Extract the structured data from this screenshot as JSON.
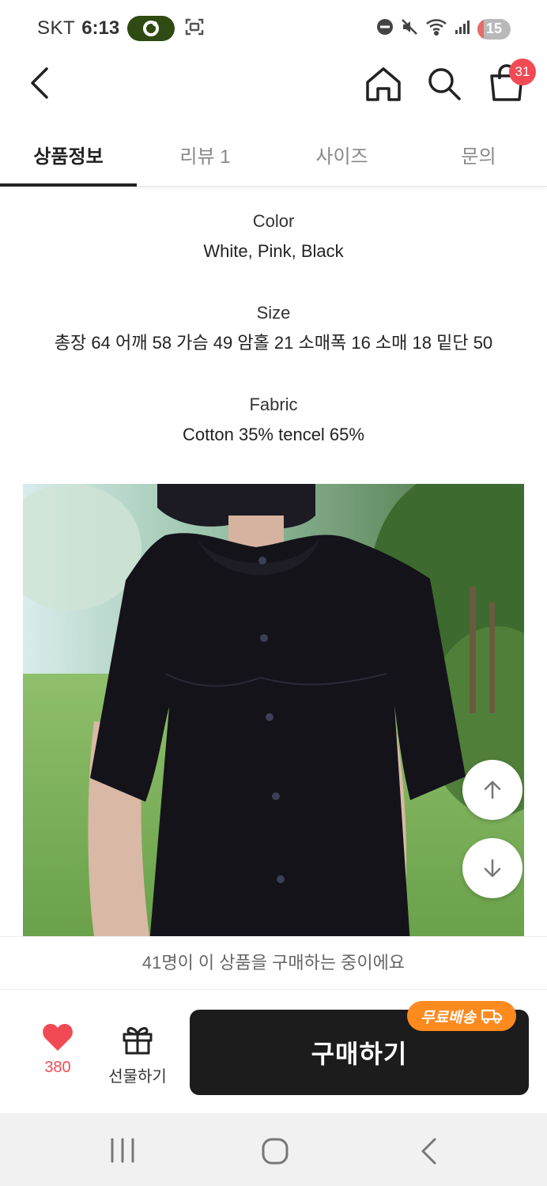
{
  "status_bar": {
    "carrier": "SKT",
    "time": "6:13",
    "battery": "15"
  },
  "header": {
    "cart_count": "31"
  },
  "tabs": [
    {
      "label": "상품정보",
      "active": true
    },
    {
      "label": "리뷰 1",
      "active": false
    },
    {
      "label": "사이즈",
      "active": false
    },
    {
      "label": "문의",
      "active": false
    }
  ],
  "product_info": {
    "color_title": "Color",
    "color_value": "White, Pink, Black",
    "size_title": "Size",
    "size_value": "총장 64 어깨 58 가슴 49 암홀 21 소매폭 16 소매 18 밑단 50",
    "fabric_title": "Fabric",
    "fabric_value": "Cotton 35% tencel 65%"
  },
  "notice": {
    "text": "41명이 이 상품을 구매하는 중이에요"
  },
  "bottom_bar": {
    "like_count": "380",
    "gift_label": "선물하기",
    "buy_label": "구매하기",
    "shipping_badge": "무료배송"
  },
  "colors": {
    "accent_red": "#f24a55",
    "badge_orange": "#ff8a1e",
    "buy_button": "#1c1c1c"
  }
}
